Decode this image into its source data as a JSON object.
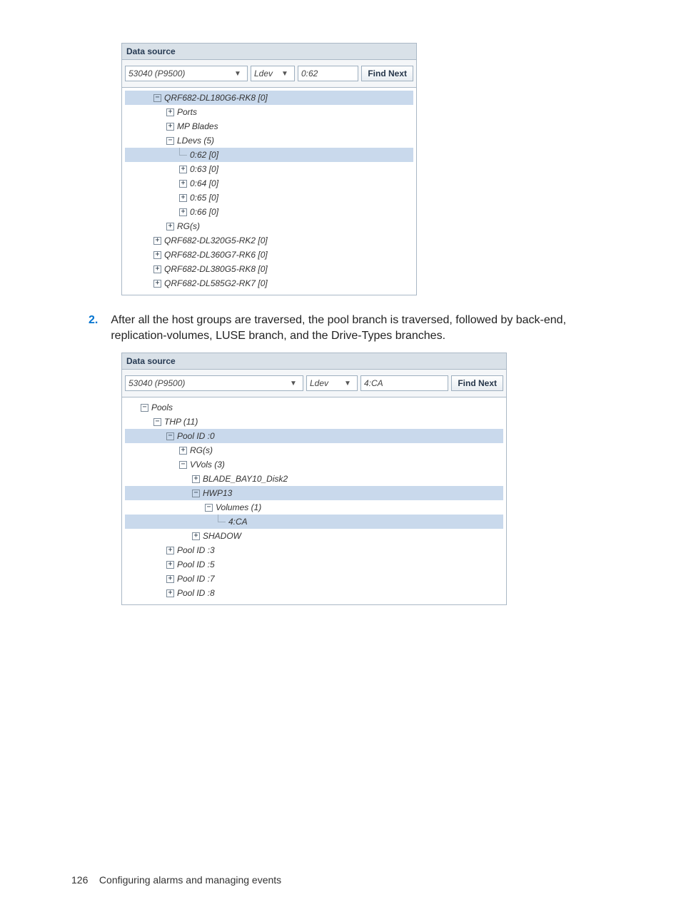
{
  "panelA": {
    "title": "Data source",
    "combo1": "53040 (P9500)",
    "combo2": "Ldev",
    "search": "0:62",
    "button": "Find Next",
    "tree": [
      {
        "depth": 2,
        "toggle": "minus",
        "label": "QRF682-DL180G6-RK8 [0]",
        "sel": true
      },
      {
        "depth": 3,
        "toggle": "plus",
        "label": "Ports"
      },
      {
        "depth": 3,
        "toggle": "plus",
        "label": "MP Blades"
      },
      {
        "depth": 3,
        "toggle": "minus",
        "label": "LDevs (5)"
      },
      {
        "depth": 4,
        "toggle": "leaf",
        "label": "0:62 [0]",
        "sel": true
      },
      {
        "depth": 4,
        "toggle": "plus",
        "label": "0:63 [0]"
      },
      {
        "depth": 4,
        "toggle": "plus",
        "label": "0:64 [0]"
      },
      {
        "depth": 4,
        "toggle": "plus",
        "label": "0:65 [0]"
      },
      {
        "depth": 4,
        "toggle": "plus",
        "label": "0:66 [0]"
      },
      {
        "depth": 3,
        "toggle": "plus",
        "label": "RG(s)"
      },
      {
        "depth": 2,
        "toggle": "plus",
        "label": "QRF682-DL320G5-RK2 [0]"
      },
      {
        "depth": 2,
        "toggle": "plus",
        "label": "QRF682-DL360G7-RK6 [0]"
      },
      {
        "depth": 2,
        "toggle": "plus",
        "label": "QRF682-DL380G5-RK8 [0]"
      },
      {
        "depth": 2,
        "toggle": "plus",
        "label": "QRF682-DL585G2-RK7 [0]"
      }
    ]
  },
  "step": {
    "num": "2.",
    "text": "After all the host groups are traversed, the pool branch is traversed, followed by back-end, replication-volumes, LUSE branch, and the Drive-Types branches."
  },
  "panelB": {
    "title": "Data source",
    "combo1": "53040 (P9500)",
    "combo2": "Ldev",
    "search": "4:CA",
    "button": "Find Next",
    "tree": [
      {
        "depth": 1,
        "toggle": "minus",
        "label": "Pools"
      },
      {
        "depth": 2,
        "toggle": "minus",
        "label": "THP (11)"
      },
      {
        "depth": 3,
        "toggle": "minus",
        "label": "Pool ID :0",
        "sel": true
      },
      {
        "depth": 4,
        "toggle": "plus",
        "label": "RG(s)"
      },
      {
        "depth": 4,
        "toggle": "minus",
        "label": "VVols (3)"
      },
      {
        "depth": 5,
        "toggle": "plus",
        "label": "BLADE_BAY10_Disk2"
      },
      {
        "depth": 5,
        "toggle": "minus",
        "label": "HWP13",
        "sel": true
      },
      {
        "depth": 6,
        "toggle": "minus",
        "label": "Volumes (1)"
      },
      {
        "depth": 7,
        "toggle": "leaf",
        "label": "4:CA",
        "sel": true
      },
      {
        "depth": 5,
        "toggle": "plus",
        "label": "SHADOW"
      },
      {
        "depth": 3,
        "toggle": "plus",
        "label": "Pool ID :3"
      },
      {
        "depth": 3,
        "toggle": "plus",
        "label": "Pool ID :5"
      },
      {
        "depth": 3,
        "toggle": "plus",
        "label": "Pool ID :7"
      },
      {
        "depth": 3,
        "toggle": "plus",
        "label": "Pool ID :8"
      }
    ]
  },
  "footer": {
    "pageNum": "126",
    "title": "Configuring alarms and managing events"
  }
}
